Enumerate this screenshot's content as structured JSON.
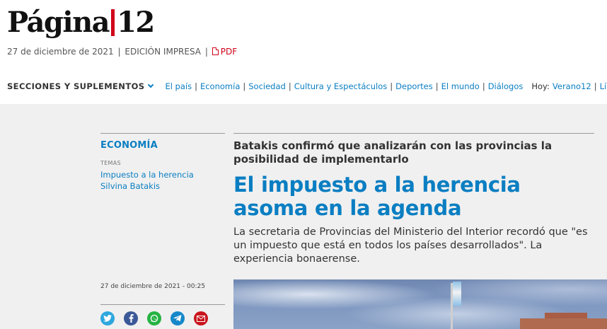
{
  "header": {
    "logo_text_left": "Página",
    "logo_text_right": "12",
    "date": "27 de diciembre de 2021",
    "edition": "EDICIÓN IMPRESA",
    "pdf_label": "PDF"
  },
  "nav": {
    "sections_label": "SECCIONES Y SUPLEMENTOS",
    "links": [
      "El país",
      "Economía",
      "Sociedad",
      "Cultura y Espectáculos",
      "Deportes",
      "El mundo",
      "Diálogos"
    ],
    "today_label": "Hoy:",
    "today_links": [
      "Verano12",
      "Líbero"
    ]
  },
  "sidebar": {
    "section": "ECONOMÍA",
    "temas_label": "TEMAS",
    "temas": [
      "Impuesto a la herencia",
      "Silvina Batakis"
    ],
    "published": "27 de diciembre de 2021 - 00:25",
    "share_icons": [
      "twitter-icon",
      "facebook-icon",
      "whatsapp-icon",
      "telegram-icon",
      "email-icon"
    ]
  },
  "article": {
    "kicker": "Batakis confirmó que analizarán con las provincias la posibilidad de implementarlo",
    "headline": "El impuesto a la herencia asoma en la agenda",
    "subhead": "La secretaria de Provincias del Ministerio del Interior recordó que \"es un impuesto que está en todos los países desarrollados\". La experiencia bonaerense."
  },
  "colors": {
    "accent": "#0a7ec2",
    "logo_red": "#d0021b",
    "background_main": "#f0f0f0"
  }
}
